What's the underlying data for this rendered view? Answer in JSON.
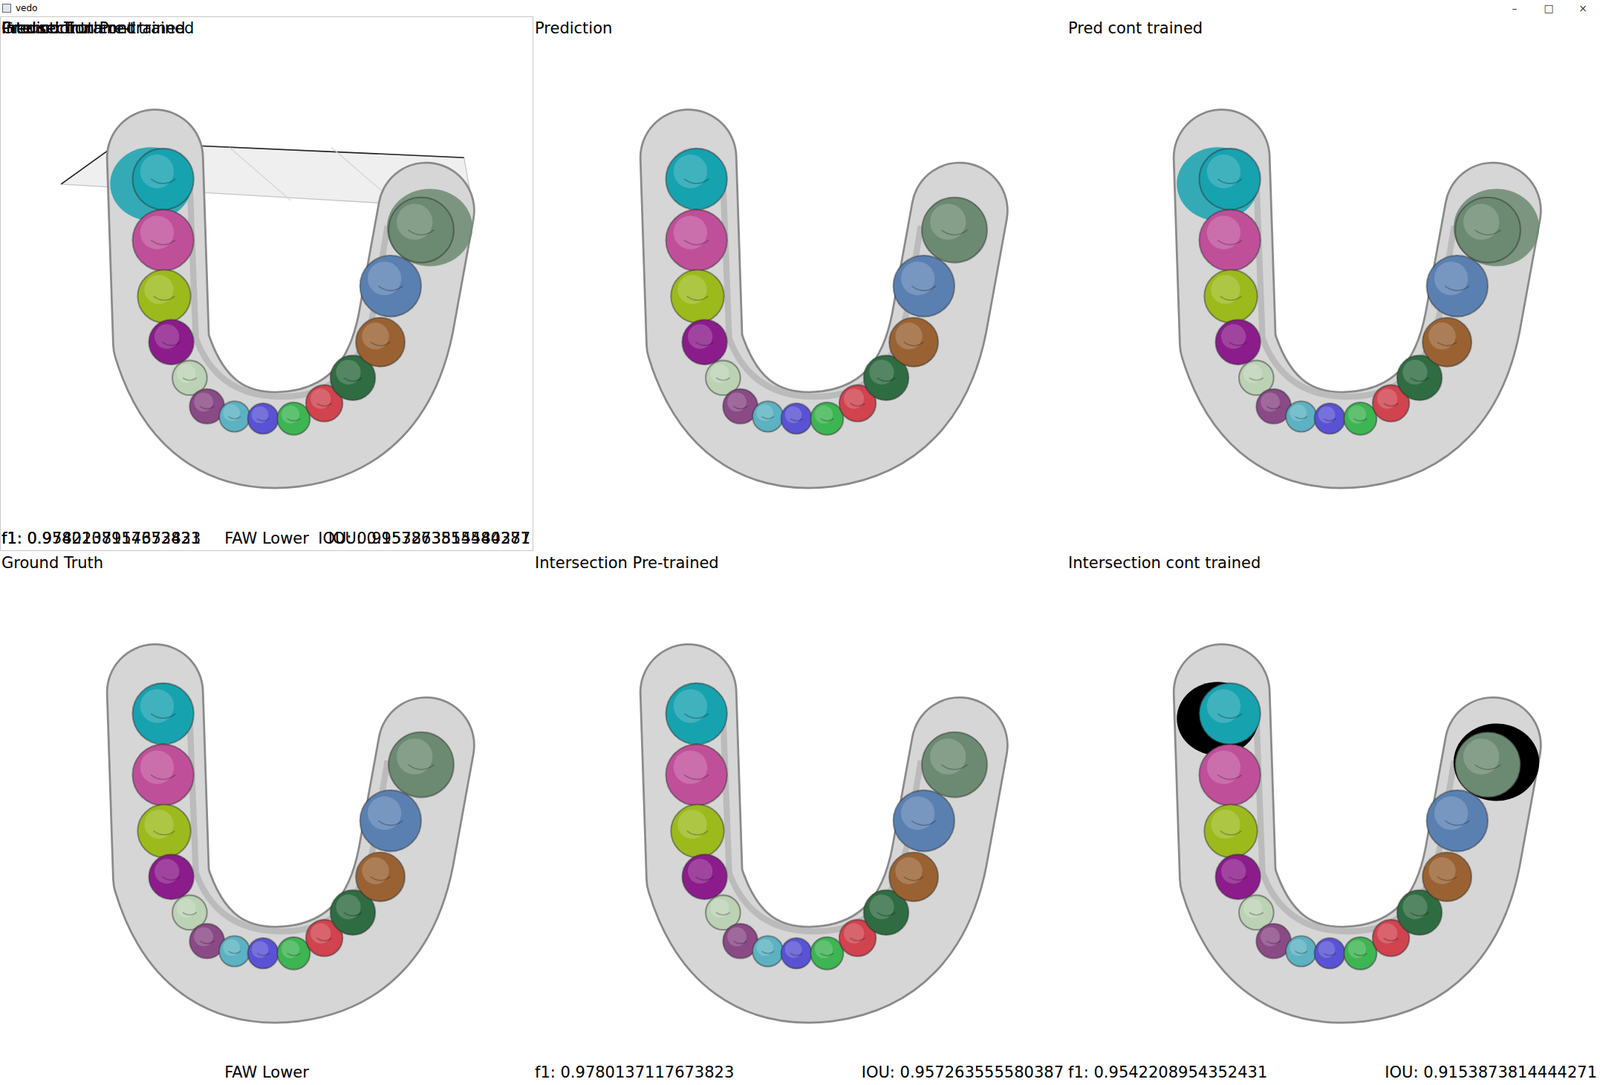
{
  "window": {
    "title": "vedo",
    "controls": [
      "–",
      "□",
      "×"
    ]
  },
  "teeth": [
    {
      "color": "#17a2b0",
      "error": true
    },
    {
      "color": "#c04f9a",
      "error": false
    },
    {
      "color": "#9cba1c",
      "error": false
    },
    {
      "color": "#8c1c8c",
      "error": false
    },
    {
      "color": "#bcd2b4",
      "error": false
    },
    {
      "color": "#8a4a86",
      "error": false
    },
    {
      "color": "#5cb2c2",
      "error": false
    },
    {
      "color": "#5a52d4",
      "error": false
    },
    {
      "color": "#3db552",
      "error": false
    },
    {
      "color": "#d0434f",
      "error": false
    },
    {
      "color": "#2f6c42",
      "error": false
    },
    {
      "color": "#9a6232",
      "error": false
    },
    {
      "color": "#5a80b2",
      "error": false
    },
    {
      "color": "#6c8a72",
      "error": true
    }
  ],
  "viewports": [
    {
      "titles": [
        "Prediction",
        "Pred cont trained",
        "Intersection Pre-trained",
        "Intersection cont trained",
        "Ground Truth"
      ],
      "footer": {
        "left": [
          "f1: 0.9780137117673823",
          "f1: 0.9542208954352431"
        ],
        "center": [
          "FAW Lower"
        ],
        "right": [
          "IOU: 0.957263555580387",
          "IOU: 0.9153873814444271"
        ]
      },
      "spill": true,
      "highlight_errors": false,
      "framed": true,
      "axis_ticks": [
        "30",
        "40",
        "30"
      ]
    },
    {
      "titles": [
        "Prediction"
      ],
      "footer": {
        "left": [],
        "center": [],
        "right": []
      },
      "spill": false,
      "highlight_errors": false,
      "framed": false,
      "axis_ticks": []
    },
    {
      "titles": [
        "Pred cont trained"
      ],
      "footer": {
        "left": [],
        "center": [],
        "right": []
      },
      "spill": true,
      "highlight_errors": false,
      "framed": false,
      "axis_ticks": []
    },
    {
      "titles": [
        "Ground Truth"
      ],
      "footer": {
        "left": [],
        "center": [
          "FAW Lower"
        ],
        "right": []
      },
      "spill": false,
      "highlight_errors": false,
      "framed": false,
      "axis_ticks": []
    },
    {
      "titles": [
        "Intersection Pre-trained"
      ],
      "footer": {
        "left": [
          "f1: 0.9780137117673823"
        ],
        "center": [],
        "right": [
          "IOU: 0.957263555580387"
        ]
      },
      "spill": false,
      "highlight_errors": false,
      "framed": false,
      "axis_ticks": []
    },
    {
      "titles": [
        "Intersection cont trained"
      ],
      "footer": {
        "left": [
          "f1: 0.9542208954352431"
        ],
        "center": [],
        "right": [
          "IOU: 0.9153873814444271"
        ]
      },
      "spill": false,
      "highlight_errors": true,
      "framed": false,
      "axis_ticks": []
    }
  ]
}
